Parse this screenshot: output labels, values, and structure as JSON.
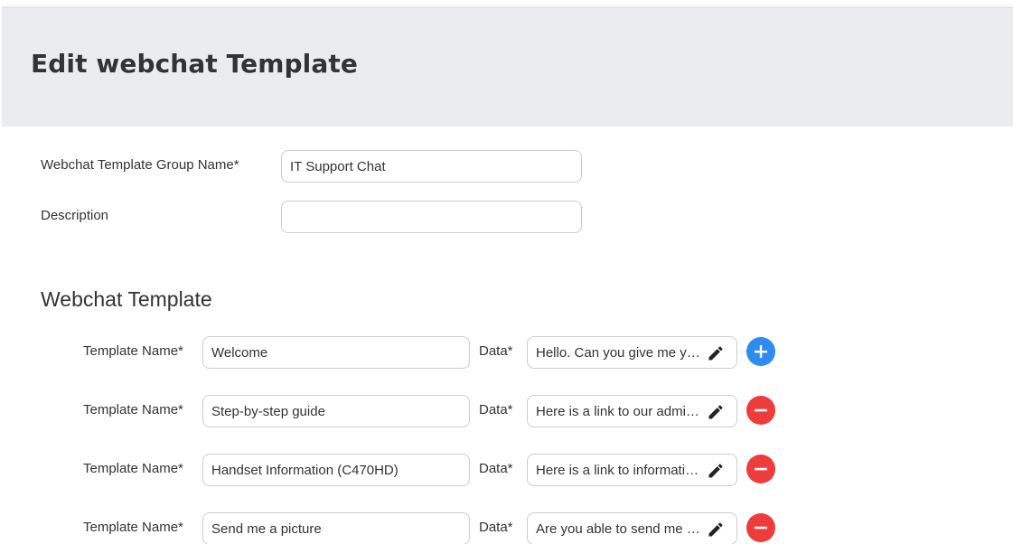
{
  "header": {
    "title": "Edit webchat Template"
  },
  "form": {
    "group_name_label": "Webchat Template Group Name*",
    "group_name_value": "IT Support Chat",
    "description_label": "Description",
    "description_value": ""
  },
  "templates_section": {
    "title": "Webchat Template",
    "name_label": "Template Name*",
    "data_label": "Data*",
    "rows": [
      {
        "name": "Welcome",
        "data_preview": "Hello. Can you give me your name and phone number",
        "action": "add",
        "action_icon": "plus-icon",
        "action_color": "#2e8cf0"
      },
      {
        "name": "Step-by-step guide",
        "data_preview": "Here is a link to our admin guide",
        "action": "remove",
        "action_icon": "minus-icon",
        "action_color": "#ee3b3b"
      },
      {
        "name": "Handset Information (C470HD)",
        "data_preview": "Here is a link to information about the handset",
        "action": "remove",
        "action_icon": "minus-icon",
        "action_color": "#ee3b3b"
      },
      {
        "name": "Send me a picture",
        "data_preview": "Are you able to send me a picture",
        "action": "remove",
        "action_icon": "minus-icon",
        "action_color": "#ee3b3b"
      }
    ]
  },
  "colors": {
    "header_background": "#eaedf0",
    "add_button": "#2e8cf0",
    "remove_button": "#ee3b3b",
    "text": "#333333",
    "input_border": "#c9cdd2"
  },
  "icons": {
    "edit": "pencil-icon",
    "add": "plus-icon",
    "remove": "minus-icon"
  }
}
